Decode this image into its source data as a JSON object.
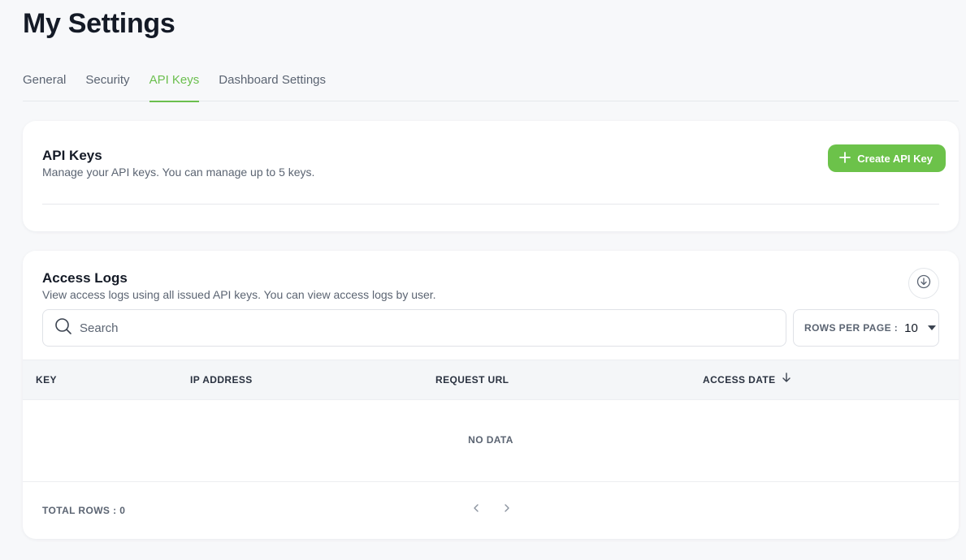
{
  "page": {
    "title": "My Settings"
  },
  "tabs": [
    {
      "label": "General",
      "active": false
    },
    {
      "label": "Security",
      "active": false
    },
    {
      "label": "API Keys",
      "active": true
    },
    {
      "label": "Dashboard Settings",
      "active": false
    }
  ],
  "api_keys": {
    "title": "API Keys",
    "subtitle": "Manage your API keys. You can manage up to 5 keys.",
    "create_button": {
      "label": "Create API Key",
      "icon": "plus-icon"
    }
  },
  "access_logs": {
    "title": "Access Logs",
    "subtitle": "View access logs using all issued API keys. You can view access logs by user.",
    "download_icon": "download-circle-icon",
    "search": {
      "placeholder": "Search",
      "value": "",
      "icon": "search-icon"
    },
    "rows_per_page": {
      "label": "ROWS PER PAGE :",
      "value": "10"
    },
    "columns": [
      {
        "label": "KEY"
      },
      {
        "label": "IP ADDRESS"
      },
      {
        "label": "REQUEST URL"
      },
      {
        "label": "ACCESS DATE",
        "sort_icon": "arrow-down-icon"
      }
    ],
    "rows": [],
    "empty_text": "NO DATA",
    "total_rows": "TOTAL ROWS : 0"
  },
  "colors": {
    "accent": "#6cc24a",
    "tab_active": "#6bbf4e",
    "text_primary": "#141a26",
    "text_secondary": "#5b6472",
    "background": "#f7f8fa"
  }
}
